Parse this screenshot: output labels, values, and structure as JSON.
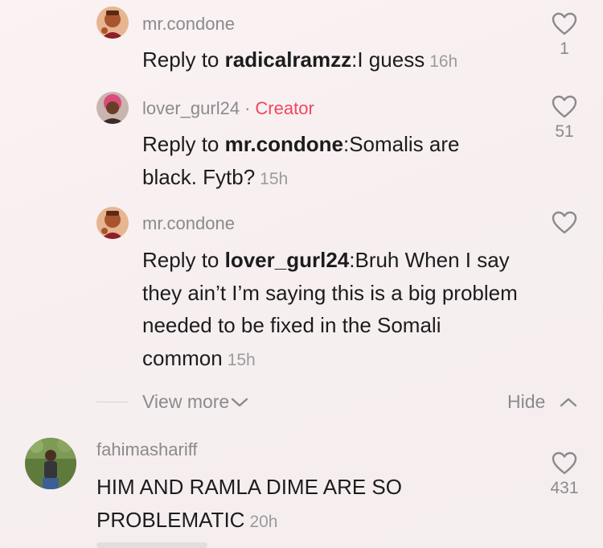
{
  "replies": [
    {
      "username": "mr.condone",
      "reply_prefix": "Reply to ",
      "reply_to": "radicalramzz",
      "text": ":I guess",
      "time": "16h",
      "likes": "1"
    },
    {
      "username": "lover_gurl24",
      "creator_dot": "·",
      "creator_label": "Creator",
      "reply_prefix": "Reply to ",
      "reply_to": "mr.condone",
      "text": ":Somalis are black. Fytb?",
      "time": "15h",
      "likes": "51"
    },
    {
      "username": "mr.condone",
      "reply_prefix": "Reply to ",
      "reply_to": "lover_gurl24",
      "text": ":Bruh When I say they ain’t I’m saying this is a big problem needed to be fixed in the Somali common",
      "time": "15h",
      "likes": ""
    }
  ],
  "thread_controls": {
    "view_more": "View more",
    "hide": "Hide"
  },
  "comment": {
    "username": "fahimashariff",
    "text": "HIM AND RAMLA DIME ARE SO PROBLEMATIC",
    "time": "20h",
    "likes": "431"
  },
  "colors": {
    "creator": "#f0455f",
    "meta_gray": "#8a8a8e",
    "text": "#1c1c1e"
  },
  "icons": [
    "heart-icon",
    "chevron-down-icon",
    "chevron-up-icon"
  ]
}
